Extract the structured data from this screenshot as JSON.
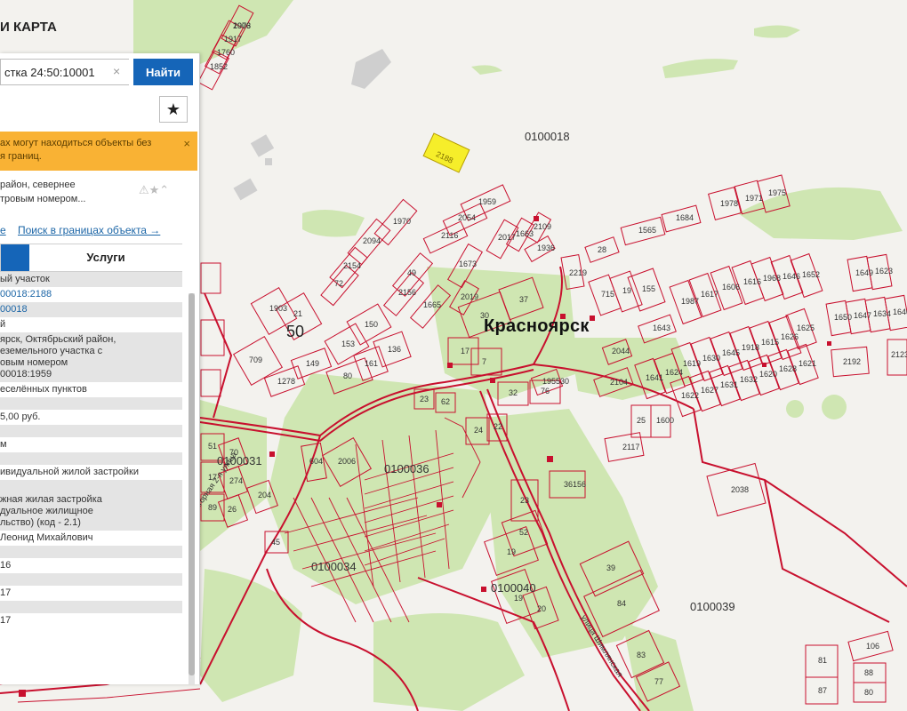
{
  "app": {
    "title": "И КАРТА"
  },
  "search": {
    "value": "стка 24:50:10001",
    "button": "Найти",
    "clear": "×"
  },
  "toolbar": {
    "star": "★"
  },
  "warning": {
    "text": "ах могут находиться объекты без\nя границ.",
    "close": "×"
  },
  "object": {
    "header": "район, севернее\nтровым номером...",
    "icons": "⚠★⌃",
    "link_left": "е",
    "link_search": "Поиск в границах объекта →"
  },
  "tabs": {
    "info": "",
    "services": "Услуги"
  },
  "details": [
    {
      "text": "ый участок",
      "gray": true
    },
    {
      "text": "00018:2188",
      "gray": false,
      "link": true
    },
    {
      "text": "00018",
      "gray": true,
      "link": true
    },
    {
      "text": "й",
      "gray": false
    },
    {
      "text": "ярск, Октябрьский район,\nеземельного участка с\nовым номером\n00018:1959",
      "gray": true
    },
    {
      "text": "еселённых пунктов",
      "gray": false
    },
    {
      "text": "",
      "gray": true
    },
    {
      "text": "5,00 руб.",
      "gray": false
    },
    {
      "text": "",
      "gray": true
    },
    {
      "text": "м",
      "gray": false
    },
    {
      "text": "",
      "gray": true
    },
    {
      "text": "ивидуальной жилой застройки",
      "gray": false
    },
    {
      "text": "",
      "gray": true
    },
    {
      "text": "жная жилая застройка\nдуальное жилищное\nльство) (код - 2.1)",
      "gray": true
    },
    {
      "text": "Леонид Михайлович",
      "gray": false
    },
    {
      "text": "",
      "gray": true
    },
    {
      "text": "16",
      "gray": false
    },
    {
      "text": "",
      "gray": true
    },
    {
      "text": "17",
      "gray": false
    },
    {
      "text": "",
      "gray": true
    },
    {
      "text": "17",
      "gray": false
    }
  ],
  "map": {
    "city": "Красноярск",
    "quarters": [
      "0100018",
      "0100031",
      "0100036",
      "0100034",
      "0100040",
      "0100039"
    ],
    "streets": [
      "Пригорная 2-я улица",
      "улица Шимлянская"
    ],
    "highlighted_parcel": "2188",
    "parcel_numbers": [
      "2076",
      "1917",
      "1760",
      "1852",
      "1959",
      "2054",
      "2116",
      "1970",
      "2094",
      "2154",
      "72",
      "49",
      "2156",
      "1665",
      "1673",
      "2019",
      "2017",
      "1663",
      "2109",
      "1936",
      "28",
      "2219",
      "715",
      "19",
      "155",
      "1565",
      "1684",
      "1978",
      "1971",
      "1975",
      "1987",
      "1617",
      "1606",
      "1616",
      "1968",
      "1646",
      "1652",
      "1649",
      "1623",
      "1650",
      "1647",
      "1634",
      "1640",
      "1643",
      "1625",
      "1619",
      "1630",
      "1645",
      "1918",
      "1615",
      "1626",
      "1641",
      "1624",
      "1622",
      "1627",
      "1631",
      "1632",
      "1620",
      "1628",
      "1621",
      "2192",
      "2123",
      "2104",
      "2044",
      "25",
      "1600",
      "2117",
      "2038",
      "195530",
      "1903",
      "21",
      "709",
      "1278",
      "149",
      "153",
      "150",
      "80",
      "161",
      "136",
      "17",
      "7",
      "30",
      "37",
      "23",
      "62",
      "24",
      "22",
      "32",
      "76",
      "23",
      "36156",
      "52",
      "19",
      "19",
      "20",
      "39",
      "84",
      "83",
      "77",
      "81",
      "87",
      "106",
      "88",
      "80",
      "45",
      "51",
      "17",
      "89",
      "70",
      "274",
      "26",
      "204",
      "604",
      "2006",
      "1903"
    ],
    "district_label": "50",
    "colors": {
      "parcel": "#c8102e",
      "green": "#cfe6b2",
      "background": "#f3f2ee",
      "highlight": "#f6ee2a"
    }
  }
}
